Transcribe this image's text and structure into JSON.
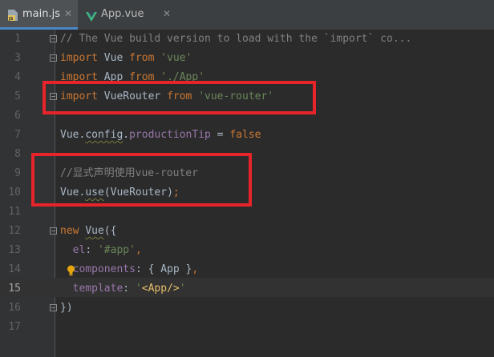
{
  "tabs": [
    {
      "label": "main.js",
      "close": "✕",
      "active": true
    },
    {
      "label": "App.vue",
      "close": "✕",
      "active": false
    }
  ],
  "lines": [
    {
      "n": "1",
      "text": "// The Vue build version to load with the `import` co..."
    },
    {
      "n": "3",
      "text": "import Vue from 'vue'"
    },
    {
      "n": "4",
      "text": "import App from './App'"
    },
    {
      "n": "5",
      "text": "import VueRouter from 'vue-router'"
    },
    {
      "n": "6",
      "text": ""
    },
    {
      "n": "7",
      "text": "Vue.config.productionTip = false"
    },
    {
      "n": "8",
      "text": ""
    },
    {
      "n": "9",
      "text": "//显式声明使用vue-router"
    },
    {
      "n": "10",
      "text": "Vue.use(VueRouter);"
    },
    {
      "n": "11",
      "text": ""
    },
    {
      "n": "12",
      "text": "new Vue({"
    },
    {
      "n": "13",
      "text": "  el: '#app',"
    },
    {
      "n": "14",
      "text": "  components: { App },"
    },
    {
      "n": "15",
      "text": "  template: '<App/>'"
    },
    {
      "n": "16",
      "text": "})"
    },
    {
      "n": "17",
      "text": ""
    }
  ],
  "colors": {
    "keyword": "#cc7832",
    "string": "#6a8759",
    "comment": "#808080",
    "property": "#9876aa",
    "annotation_box": "#e8242b"
  },
  "icons": {
    "js_file": "js-file-icon",
    "vue_file": "vue-file-icon",
    "intention": "lightbulb-icon"
  }
}
